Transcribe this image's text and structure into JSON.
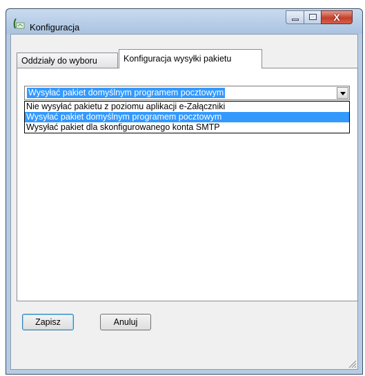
{
  "window": {
    "title": "Konfiguracja",
    "close_glyph": "X"
  },
  "tabs": [
    {
      "label": "Oddziały do wyboru",
      "active": false
    },
    {
      "label": "Konfiguracja wysyłki pakietu",
      "active": true
    }
  ],
  "send_method": {
    "selected": "Wysyłać pakiet domyślnym programem pocztowym",
    "options": [
      "Nie wysyłać pakietu z poziomu aplikacji e-Załączniki",
      "Wysyłać pakiet domyślnym programem pocztowym",
      "Wysyłać pakiet dla skonfigurowanego konta SMTP"
    ]
  },
  "buttons": {
    "save": "Zapisz",
    "cancel": "Anuluj"
  },
  "colors": {
    "selection": "#3399ff",
    "close_button": "#c3402b",
    "window_frame": "#b7cce4"
  }
}
